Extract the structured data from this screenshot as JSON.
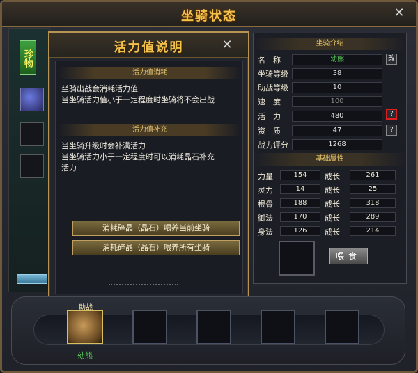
{
  "window": {
    "title": "坐骑状态",
    "close_glyph": "✕"
  },
  "left": {
    "rare_tab_label": "珍物"
  },
  "dialog": {
    "title": "活力值说明",
    "close_glyph": "✕",
    "section1": "活力值消耗",
    "section1_lines": [
      "坐骑出战会消耗活力值",
      "当坐骑活力值小于一定程度时坐骑将不会出战"
    ],
    "section2": "活力值补充",
    "section2_lines": [
      "当坐骑升级时会补满活力",
      "当坐骑活力小于一定程度时可以消耗晶石补充",
      "活力"
    ],
    "btn_feed_current": "消耗碎晶（晶石）喂养当前坐骑",
    "btn_feed_all": "消耗碎晶（晶石）喂养所有坐骑"
  },
  "intro": {
    "header": "坐骑介绍",
    "name_label": "名　称",
    "name_value": "幼熊",
    "rename_btn": "改",
    "level_label": "坐骑等级",
    "level_value": "38",
    "assist_label": "助战等级",
    "assist_value": "10",
    "speed_label": "速　度",
    "speed_value": "100",
    "vitality_label": "活　力",
    "vitality_value": "480",
    "vitality_help": "?",
    "aptitude_label": "资　质",
    "aptitude_value": "47",
    "aptitude_help": "?",
    "score_label": "战力评分",
    "score_value": "1268"
  },
  "attrs": {
    "header": "基础属性",
    "growth_label": "成长",
    "rows": [
      {
        "label": "力量",
        "value": "154",
        "growth": "261"
      },
      {
        "label": "灵力",
        "value": "14",
        "growth": "25"
      },
      {
        "label": "根骨",
        "value": "188",
        "growth": "318"
      },
      {
        "label": "御法",
        "value": "170",
        "growth": "289"
      },
      {
        "label": "身法",
        "value": "126",
        "growth": "214"
      }
    ],
    "feed_button": "喂食"
  },
  "bottom": {
    "assist_badge": "助战",
    "active_mount_name": "幼熊"
  },
  "colors": {
    "title_gold": "#f2c24a",
    "name_green": "#5ad05a",
    "highlight_red": "#e02020"
  }
}
